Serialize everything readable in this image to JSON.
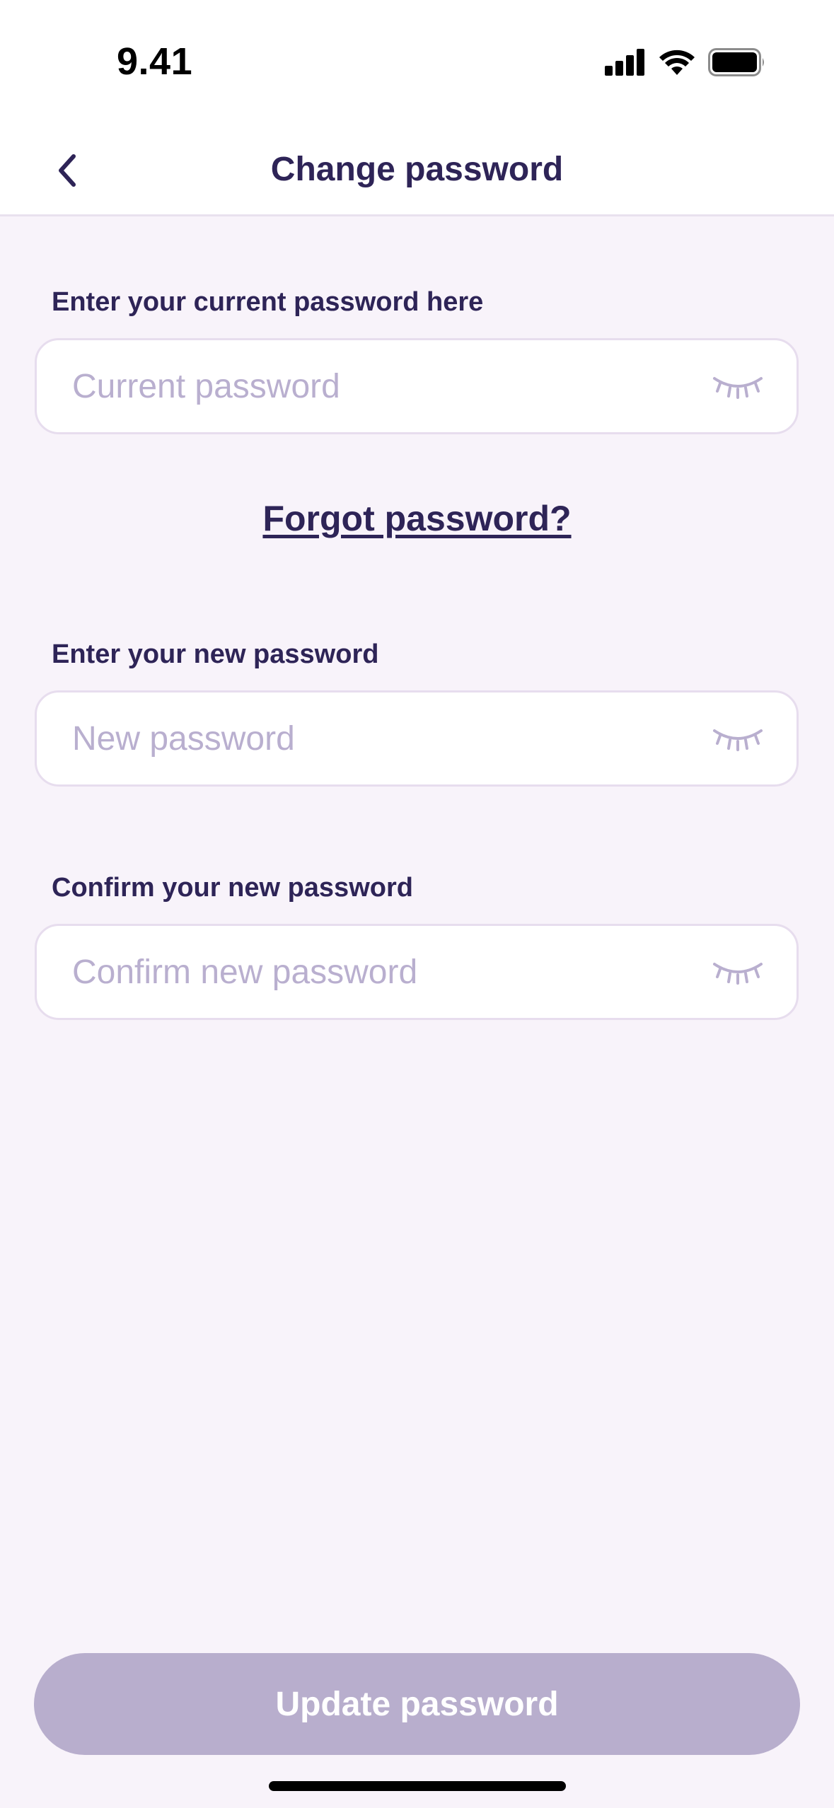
{
  "status_bar": {
    "time": "9.41"
  },
  "nav": {
    "title": "Change password",
    "back_icon": "chevron-left-icon"
  },
  "fields": {
    "current": {
      "label": "Enter your current password here",
      "placeholder": "Current password",
      "value": ""
    },
    "new": {
      "label": "Enter your new password",
      "placeholder": "New password",
      "value": ""
    },
    "confirm": {
      "label": "Confirm your new password",
      "placeholder": "Confirm new password",
      "value": ""
    }
  },
  "forgot_link": "Forgot password?",
  "update_button": {
    "label": "Update password",
    "enabled": false
  },
  "colors": {
    "primary_text": "#2E2457",
    "placeholder": "#B9AFCF",
    "background": "#F8F3FA",
    "button_disabled": "#B8AECD"
  },
  "icons": {
    "password_toggle": "eye-closed-icon"
  }
}
